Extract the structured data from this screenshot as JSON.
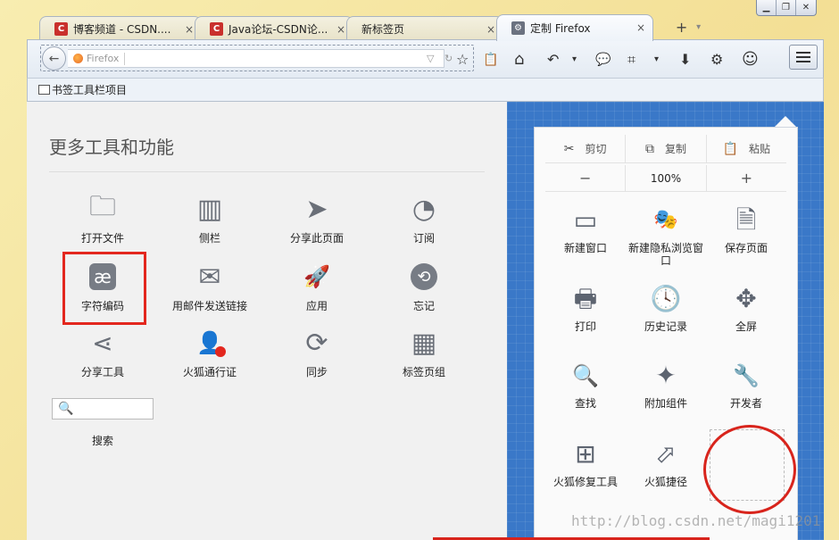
{
  "window": {
    "minimize": "▁",
    "restore": "❐",
    "close": "✕"
  },
  "tabs": [
    {
      "label": "博客频道 - CSDN....",
      "icon": "csdn-icon",
      "close": "×"
    },
    {
      "label": "Java论坛-CSDN论...",
      "icon": "csdn-icon",
      "close": "×"
    },
    {
      "label": "新标签页",
      "icon": "",
      "close": "×"
    },
    {
      "label": "定制 Firefox",
      "icon": "gear-icon",
      "close": "×"
    }
  ],
  "newtab": {
    "plus": "+",
    "dropdown": "▾"
  },
  "urlbar": {
    "placeholder": "Firefox",
    "dropdown": "▽",
    "reload": "↻"
  },
  "toolbar": {
    "star": "☆",
    "clipboard": "📋",
    "home": "⌂",
    "undo": "↶",
    "chat": "💬",
    "crop": "⌗",
    "download": "⬇",
    "gear": "⚙",
    "smile": "☺",
    "caret": "▾"
  },
  "bookmarks": {
    "label": "书签工具栏项目"
  },
  "main": {
    "title": "更多工具和功能",
    "tools": [
      {
        "label": "打开文件",
        "icon": "folder-icon"
      },
      {
        "label": "侧栏",
        "icon": "sidebar-icon"
      },
      {
        "label": "分享此页面",
        "icon": "share-page-icon"
      },
      {
        "label": "订阅",
        "icon": "rss-icon"
      },
      {
        "label": "字符编码",
        "icon": "encoding-icon"
      },
      {
        "label": "用邮件发送链接",
        "icon": "mail-icon"
      },
      {
        "label": "应用",
        "icon": "rocket-icon"
      },
      {
        "label": "忘记",
        "icon": "forget-icon"
      },
      {
        "label": "分享工具",
        "icon": "share-icon"
      },
      {
        "label": "火狐通行证",
        "icon": "account-icon"
      },
      {
        "label": "同步",
        "icon": "sync-icon"
      },
      {
        "label": "标签页组",
        "icon": "tab-groups-icon"
      }
    ],
    "search_label": "搜索",
    "search_glyph": "🔍"
  },
  "panel": {
    "edit": {
      "cut": "剪切",
      "copy": "复制",
      "paste": "粘贴",
      "cut_glyph": "✂",
      "copy_glyph": "⧉",
      "paste_glyph": "📋"
    },
    "zoom": {
      "minus": "−",
      "value": "100%",
      "plus": "+"
    },
    "items": [
      {
        "label": "新建窗口",
        "icon": "new-window-icon"
      },
      {
        "label": "新建隐私浏览窗口",
        "icon": "private-mask-icon"
      },
      {
        "label": "保存页面",
        "icon": "save-page-icon"
      },
      {
        "label": "打印",
        "icon": "print-icon"
      },
      {
        "label": "历史记录",
        "icon": "history-icon"
      },
      {
        "label": "全屏",
        "icon": "fullscreen-icon"
      },
      {
        "label": "查找",
        "icon": "find-icon"
      },
      {
        "label": "附加组件",
        "icon": "addons-icon"
      },
      {
        "label": "开发者",
        "icon": "developer-icon"
      },
      {
        "label": "火狐修复工具",
        "icon": "repair-icon"
      },
      {
        "label": "火狐捷径",
        "icon": "shortcut-icon"
      }
    ]
  },
  "watermark": "http://blog.csdn.net/magi1201",
  "glyphs": {
    "folder": "🗀",
    "sidebar": "▥",
    "share_page": "➤",
    "rss": "◔",
    "encoding": "æ",
    "mail": "✉",
    "rocket": "🚀",
    "forget": "⟲",
    "share": "⋖",
    "account": "👤",
    "sync": "⟳",
    "tab_groups": "▦",
    "new_window": "▭",
    "mask": "🎭",
    "save": "🗎",
    "print": "🖶",
    "history": "🕓",
    "fullscreen": "✥",
    "find": "🔍",
    "addons": "✦",
    "developer": "🔧",
    "repair": "⊞",
    "shortcut": "⬀"
  },
  "colors": {
    "accent_red": "#e3271e",
    "panel_blue": "#3a78c8"
  }
}
